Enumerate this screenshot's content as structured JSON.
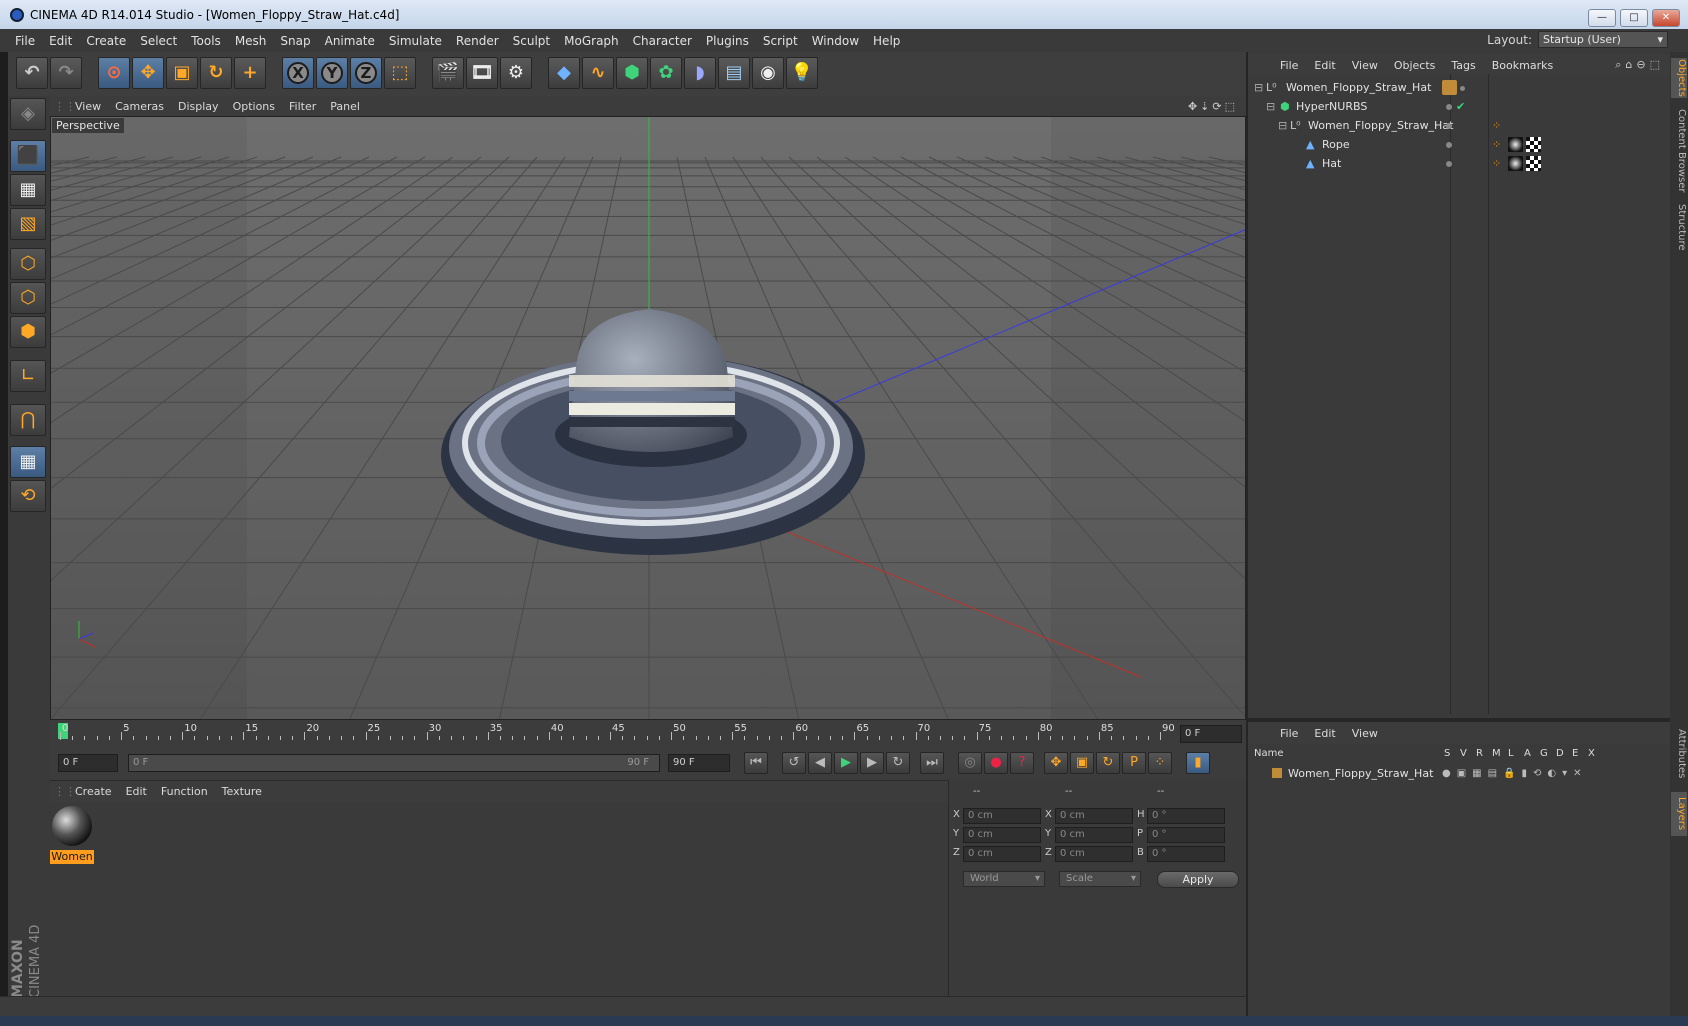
{
  "window": {
    "title": "CINEMA 4D R14.014 Studio - [Women_Floppy_Straw_Hat.c4d]",
    "min": "—",
    "max": "□",
    "close": "✕"
  },
  "menu": [
    "File",
    "Edit",
    "Create",
    "Select",
    "Tools",
    "Mesh",
    "Snap",
    "Animate",
    "Simulate",
    "Render",
    "Sculpt",
    "MoGraph",
    "Character",
    "Plugins",
    "Script",
    "Window",
    "Help"
  ],
  "layout": {
    "label": "Layout:",
    "value": "Startup (User)"
  },
  "viewport": {
    "menu": [
      "View",
      "Cameras",
      "Display",
      "Options",
      "Filter",
      "Panel"
    ],
    "label": "Perspective",
    "accent_color": "#ffa726"
  },
  "timeline": {
    "ticks": [
      "0",
      "5",
      "10",
      "15",
      "20",
      "25",
      "30",
      "35",
      "40",
      "45",
      "50",
      "55",
      "60",
      "65",
      "70",
      "75",
      "80",
      "85",
      "90"
    ],
    "current_frame": "0 F"
  },
  "transport": {
    "start": "0 F",
    "range_start": "0 F",
    "range_end": "90 F",
    "end": "90 F"
  },
  "material_manager": {
    "menu": [
      "Create",
      "Edit",
      "Function",
      "Texture"
    ],
    "materials": [
      {
        "name": "Women"
      }
    ]
  },
  "coordinates": {
    "headers": [
      "--",
      "--",
      "--"
    ],
    "rows": [
      {
        "a": "X",
        "pos": "0 cm",
        "b": "X",
        "size": "0 cm",
        "c": "H",
        "rot": "0 °"
      },
      {
        "a": "Y",
        "pos": "0 cm",
        "b": "Y",
        "size": "0 cm",
        "c": "P",
        "rot": "0 °"
      },
      {
        "a": "Z",
        "pos": "0 cm",
        "b": "Z",
        "size": "0 cm",
        "c": "B",
        "rot": "0 °"
      }
    ],
    "mode": "World",
    "size_mode": "Scale",
    "apply": "Apply"
  },
  "object_manager": {
    "menu": [
      "File",
      "Edit",
      "View",
      "Objects",
      "Tags",
      "Bookmarks"
    ],
    "objects": [
      {
        "name": "Women_Floppy_Straw_Hat",
        "indent": 0
      },
      {
        "name": "HyperNURBS",
        "indent": 1
      },
      {
        "name": "Women_Floppy_Straw_Hat",
        "indent": 2
      },
      {
        "name": "Rope",
        "indent": 3
      },
      {
        "name": "Hat",
        "indent": 3
      }
    ]
  },
  "layer_manager": {
    "menu": [
      "File",
      "Edit",
      "View"
    ],
    "columns": [
      "Name",
      "S",
      "V",
      "R",
      "M",
      "L",
      "A",
      "G",
      "D",
      "E",
      "X"
    ],
    "layers": [
      {
        "name": "Women_Floppy_Straw_Hat"
      }
    ]
  },
  "side_tabs": [
    "Objects",
    "Content Browser",
    "Structure",
    "Attributes",
    "Layers"
  ],
  "brand": {
    "line1": "MAXON",
    "line2": "CINEMA 4D"
  }
}
